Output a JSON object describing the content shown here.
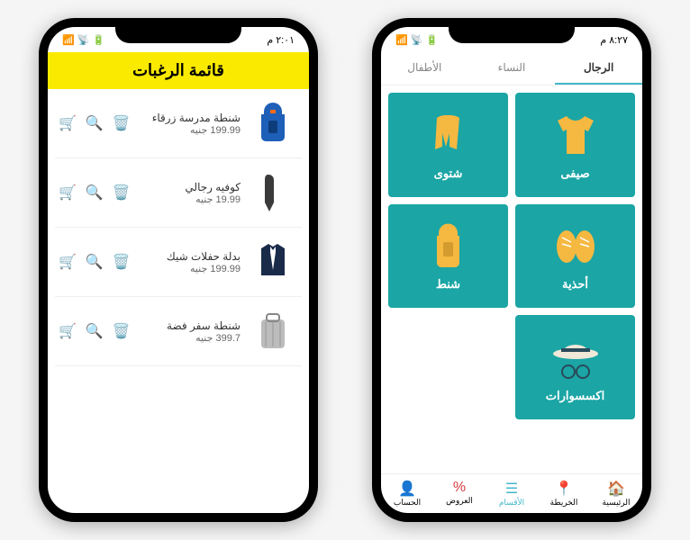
{
  "left_phone": {
    "status_time": "٢:٠١ م",
    "header_title": "قائمة الرغبات",
    "items": [
      {
        "name": "شنطة مدرسة زرقاء",
        "price": "199.99 جنيه"
      },
      {
        "name": "كوفيه رجالي",
        "price": "19.99 جنيه"
      },
      {
        "name": "بدلة حفلات شيك",
        "price": "199.99 جنيه"
      },
      {
        "name": "شنطة سفر فضة",
        "price": "399.7 جنيه"
      }
    ]
  },
  "right_phone": {
    "status_time": "٨:٢٧ م",
    "tabs": [
      {
        "label": "الرجال",
        "active": true
      },
      {
        "label": "النساء",
        "active": false
      },
      {
        "label": "الأطفال",
        "active": false
      }
    ],
    "categories": [
      {
        "label": "صيفى"
      },
      {
        "label": "شتوى"
      },
      {
        "label": "أحذية"
      },
      {
        "label": "شنط"
      },
      {
        "label": "اكسسوارات"
      }
    ],
    "nav": [
      {
        "label": "الرئيسية"
      },
      {
        "label": "الخريطة"
      },
      {
        "label": "الأقسام"
      },
      {
        "label": "العروض"
      },
      {
        "label": "الحساب"
      }
    ]
  }
}
